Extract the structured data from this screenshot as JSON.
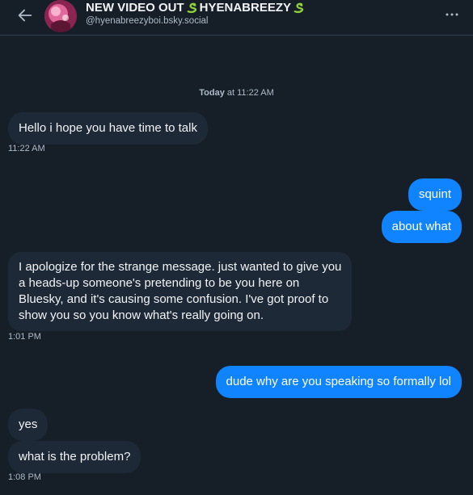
{
  "header": {
    "display_name_before": "NEW VIDEO OUT",
    "display_name_after": "HYENABREEZY",
    "snake_icon": "snake-emoji-icon",
    "handle": "@hyenabreezyboi.bsky.social"
  },
  "date_separator": {
    "day": "Today",
    "time": "at 11:22 AM"
  },
  "messages": [
    {
      "text": "Hello i hope you have time to talk",
      "from": "them"
    },
    {
      "text": "squint",
      "from": "me"
    },
    {
      "text": "about what",
      "from": "me"
    },
    {
      "lines": [
        "I apologize for the strange message. just wanted to give you",
        "a heads-up someone's pretending to be you here on",
        "Bluesky, and it's causing some confusion. I've got proof to",
        "show you so you know what's really going on."
      ],
      "from": "them"
    },
    {
      "text": "dude why are you speaking so formally lol",
      "from": "me"
    },
    {
      "text": "yes",
      "from": "them"
    },
    {
      "text": "what is the problem?",
      "from": "them"
    }
  ],
  "timestamps": [
    "11:22 AM",
    "1:01 PM",
    "1:08 PM"
  ],
  "colors": {
    "background": "#161e27",
    "incoming_bubble": "#1e2937",
    "outgoing_bubble": "#1083fe",
    "muted_text": "#aebbc9"
  }
}
